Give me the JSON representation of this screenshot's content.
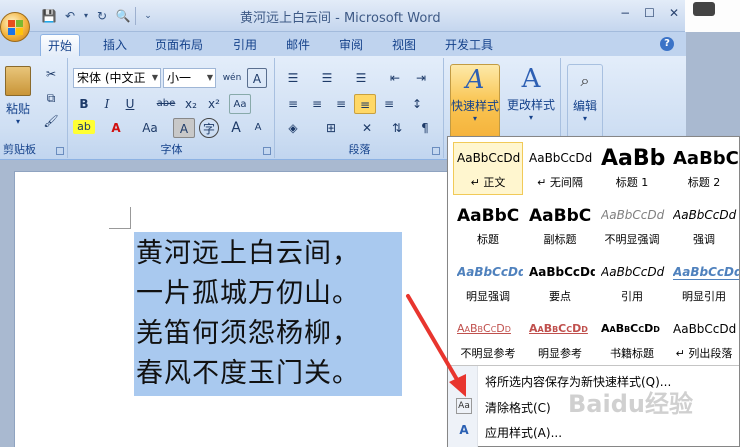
{
  "window": {
    "title": "黄河远上白云间 - Microsoft Word",
    "minimize": "−",
    "maximize": "☐",
    "close": "✕"
  },
  "tabs": [
    "开始",
    "插入",
    "页面布局",
    "引用",
    "邮件",
    "审阅",
    "视图",
    "开发工具"
  ],
  "ribbon": {
    "clipboard": {
      "label": "剪贴板",
      "paste": "粘贴"
    },
    "font": {
      "label": "字体",
      "font_name": "宋体 (中文正",
      "font_size": "小一",
      "bold": "B",
      "italic": "I",
      "underline": "U",
      "strike": "abe",
      "subscript": "x₂",
      "superscript": "x²",
      "change_case": "Aa",
      "grow": "A",
      "shrink": "A"
    },
    "paragraph": {
      "label": "段落"
    },
    "styles": {
      "quick_styles": "快速样式",
      "change_styles": "更改样式"
    },
    "editing": {
      "label": "编辑"
    }
  },
  "document": {
    "poem": [
      "黄河远上白云间，",
      "一片孤城万仞山。",
      "羌笛何须怨杨柳，",
      "春风不度玉门关。"
    ]
  },
  "gallery": {
    "styles": [
      {
        "sample": "AaBbCcDd",
        "name": "↵ 正文"
      },
      {
        "sample": "AaBbCcDd",
        "name": "↵ 无间隔"
      },
      {
        "sample": "AaBb",
        "name": "标题 1"
      },
      {
        "sample": "AaBbC",
        "name": "标题 2"
      },
      {
        "sample": "AaBbC",
        "name": "标题"
      },
      {
        "sample": "AaBbC",
        "name": "副标题"
      },
      {
        "sample": "AaBbCcDd",
        "name": "不明显强调"
      },
      {
        "sample": "AaBbCcDd",
        "name": "强调"
      },
      {
        "sample": "AaBbCcDd",
        "name": "明显强调"
      },
      {
        "sample": "AaBbCcDd",
        "name": "要点"
      },
      {
        "sample": "AaBbCcDd",
        "name": "引用"
      },
      {
        "sample": "AaBbCcDd",
        "name": "明显引用"
      },
      {
        "sample": "AaBbCcDd",
        "name": "不明显参考"
      },
      {
        "sample": "AaBbCcDd",
        "name": "明显参考"
      },
      {
        "sample": "AaBbCcDd",
        "name": "书籍标题"
      },
      {
        "sample": "AaBbCcDd",
        "name": "↵ 列出段落"
      }
    ],
    "menu": {
      "save_as_style": "将所选内容保存为新快速样式(Q)...",
      "clear_format": "清除格式(C)",
      "apply_styles": "应用样式(A)..."
    }
  },
  "watermark": "Baidu经验",
  "colors": {
    "selection": "#a9c9ef",
    "ribbon": "#cfdff3",
    "accent": "#15428b",
    "arrow": "#e8352e"
  }
}
